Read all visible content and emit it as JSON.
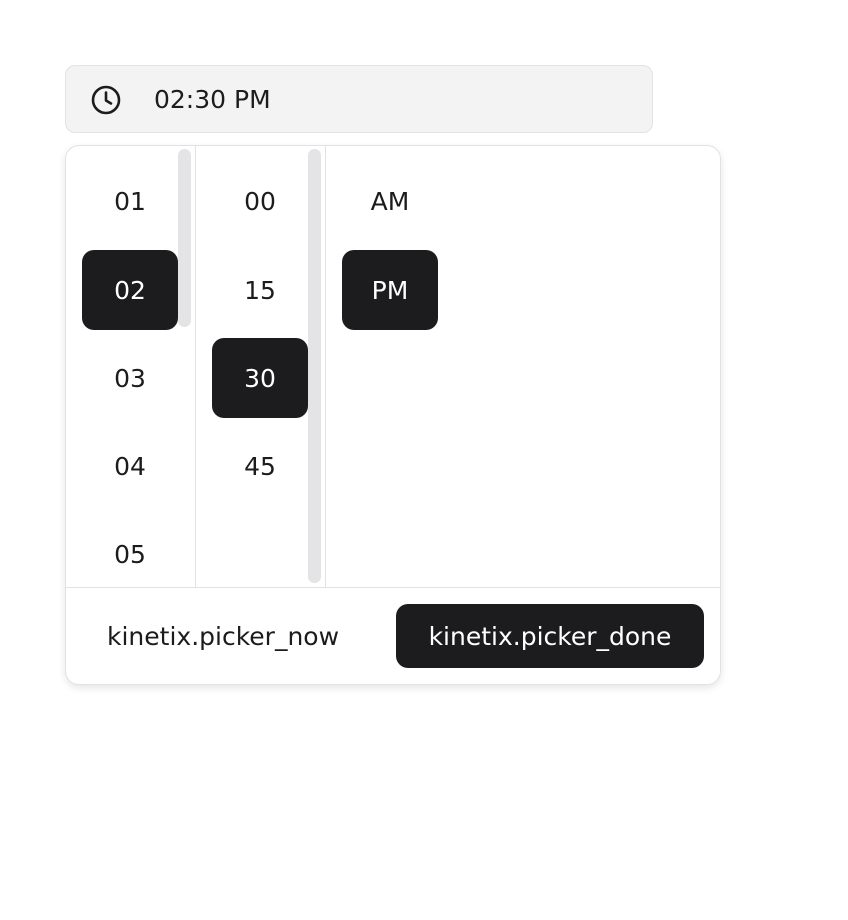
{
  "time_input": {
    "icon": "clock-icon",
    "value": "02:30 PM"
  },
  "picker": {
    "hours": [
      {
        "label": "01",
        "selected": false
      },
      {
        "label": "02",
        "selected": true
      },
      {
        "label": "03",
        "selected": false
      },
      {
        "label": "04",
        "selected": false
      },
      {
        "label": "05",
        "selected": false
      }
    ],
    "minutes": [
      {
        "label": "00",
        "selected": false
      },
      {
        "label": "15",
        "selected": false
      },
      {
        "label": "30",
        "selected": true
      },
      {
        "label": "45",
        "selected": false
      }
    ],
    "periods": [
      {
        "label": "AM",
        "selected": false
      },
      {
        "label": "PM",
        "selected": true
      }
    ]
  },
  "footer": {
    "now_label": "kinetix.picker_now",
    "done_label": "kinetix.picker_done"
  },
  "colors": {
    "selected_bg": "#1c1c1e",
    "selected_text": "#ffffff",
    "input_bg": "#f3f3f4",
    "border": "#e2e2e5"
  }
}
